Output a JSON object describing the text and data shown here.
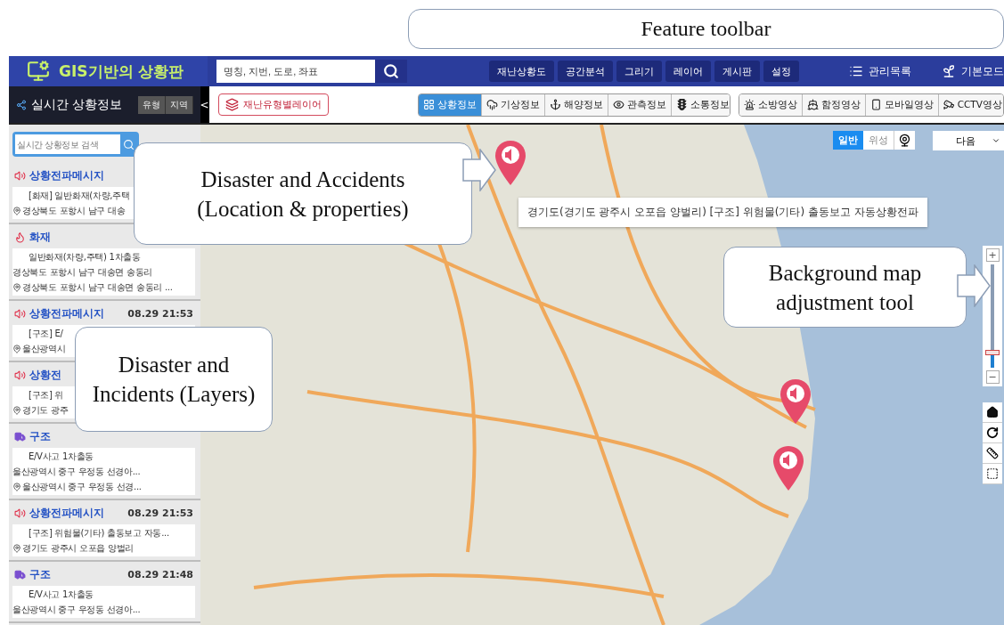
{
  "annotations": [
    {
      "lines": [
        "Feature toolbar"
      ]
    },
    {
      "lines": [
        "Disaster and Accidents",
        "(Location & properties)"
      ],
      "arrow": true
    },
    {
      "lines": [
        "Disaster and",
        "Incidents (Layers)"
      ],
      "arrow": false
    },
    {
      "lines": [
        "Background map",
        "adjustment tool"
      ],
      "arrow": true
    }
  ],
  "header": {
    "title": "GIS기반의 상황판",
    "search": {
      "placeholder": "명칭, 지번, 도로, 좌표"
    },
    "menus": [
      "재난상황도",
      "공간분석",
      "그리기",
      "레이어",
      "게시판",
      "설정"
    ],
    "links": [
      {
        "kind": "list",
        "label": "관리목록"
      },
      {
        "kind": "sprout",
        "label": "기본모드"
      }
    ]
  },
  "panel": {
    "title": "실시간 상황정보",
    "filters": [
      "유형",
      "지역"
    ],
    "collapse": "<"
  },
  "toolbar": {
    "layer_button": "재난유형별레이어",
    "info_tabs": [
      {
        "kind": "grid",
        "label": "상황정보",
        "selected": true
      },
      {
        "kind": "weather",
        "label": "기상정보",
        "selected": false
      },
      {
        "kind": "anchor",
        "label": "해양정보",
        "selected": false
      },
      {
        "kind": "eye",
        "label": "관측정보",
        "selected": false
      },
      {
        "kind": "traffic",
        "label": "소통정보",
        "selected": false
      }
    ],
    "video_buttons": [
      {
        "kind": "siren",
        "label": "소방영상"
      },
      {
        "kind": "ship",
        "label": "함정영상"
      },
      {
        "kind": "phone",
        "label": "모바일영상"
      },
      {
        "kind": "cctv",
        "label": "CCTV영상"
      }
    ]
  },
  "sidebar": {
    "search": {
      "placeholder": "실시간 상황정보 검색"
    },
    "items": [
      {
        "kind": "message",
        "title": "상황전파메시지",
        "lines": [
          "[화재] 일반화재(차량,주택"
        ],
        "location": "경상북도 포항시 남구 대송"
      },
      {
        "kind": "fire",
        "title": "화재",
        "lines": [
          "일반화재(차량,주택) 1차출동",
          "경상북도 포항시 남구 대송면 송동리"
        ],
        "location": "경상북도 포항시 남구 대송면 송동리 ..."
      },
      {
        "kind": "message",
        "title": "상황전파메시지",
        "time": "08.29 21:53",
        "lines": [
          "[구조] E/"
        ],
        "location": "울산광역시"
      },
      {
        "kind": "message",
        "title": "상황전",
        "lines": [
          "[구조] 위"
        ],
        "location": "경기도 광주"
      },
      {
        "kind": "rescue",
        "title": "구조",
        "lines": [
          "E/V사고 1차출동",
          "울산광역시 중구 우정동 선경아..."
        ],
        "location": "울산광역시 중구 우정동 선경..."
      },
      {
        "kind": "message",
        "title": "상황전파메시지",
        "time": "08.29 21:53",
        "lines": [
          "[구조] 위험물(기타) 출동보고 자동..."
        ],
        "location": "경기도 광주시 오포읍 양벌리"
      },
      {
        "kind": "rescue",
        "title": "구조",
        "time": "08.29 21:48",
        "lines": [
          "E/V사고 1차출동",
          "울산광역시 중구 우정동 선경아..."
        ]
      }
    ]
  },
  "map": {
    "views": [
      {
        "label": "일반",
        "selected": true
      },
      {
        "label": "위성",
        "selected": false
      }
    ],
    "provider": "다음",
    "tooltip": "경기도(경기도 광주시 오포읍 양벌리) [구조] 위험물(기타) 출동보고 자동상황전파",
    "markers": [
      {
        "kind": "alert"
      },
      {
        "kind": "alert"
      },
      {
        "kind": "alert"
      }
    ],
    "zoom": {
      "in": "+",
      "out": "−",
      "level": 0.15
    }
  }
}
